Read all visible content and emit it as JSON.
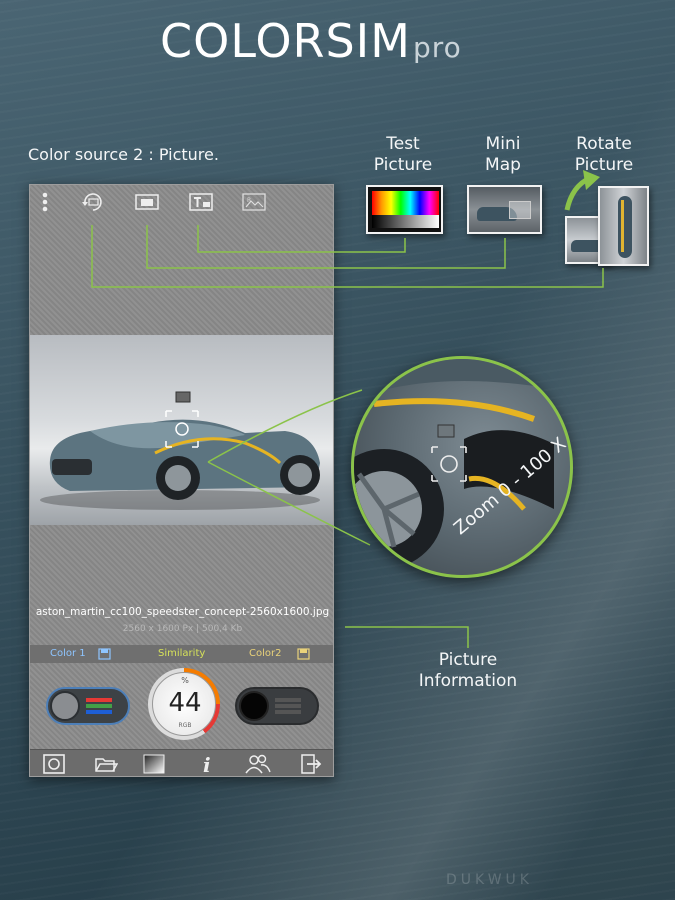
{
  "header": {
    "title_main": "COLORSIM",
    "title_suffix": "pro"
  },
  "caption": "Color source 2 : Picture.",
  "callouts": {
    "test_picture": "Test Picture",
    "mini_map": "Mini Map",
    "rotate_picture": "Rotate Picture",
    "zoom": "Zoom  0 - 100 X",
    "picture_information": "Picture Information"
  },
  "phone": {
    "toolbar_icons": [
      "menu-dots-icon",
      "rotate-picture-icon",
      "mini-map-icon",
      "test-picture-icon",
      "picture-icon"
    ],
    "file": {
      "name": "aston_martin_cc100_speedster_concept-2560x1600.jpg",
      "info": "2560 x 1600 Px  |  500,4 Kb"
    },
    "color_bar": {
      "color1": "Color 1",
      "similarity": "Similarity",
      "color2": "Color2"
    },
    "gauge": {
      "value": "44",
      "top_symbol": "%",
      "bottom_label": "RGB"
    },
    "bottom_icons": [
      "camera-icon",
      "folder-open-icon",
      "gradient-icon",
      "info-icon",
      "people-icon",
      "exit-icon"
    ]
  },
  "watermark": "DUKWUK",
  "colors": {
    "accent_green": "#8bc34a",
    "similarity_text": "#d6e25a",
    "color1_text": "#8ec5ff",
    "color2_text": "#e9d27a"
  }
}
